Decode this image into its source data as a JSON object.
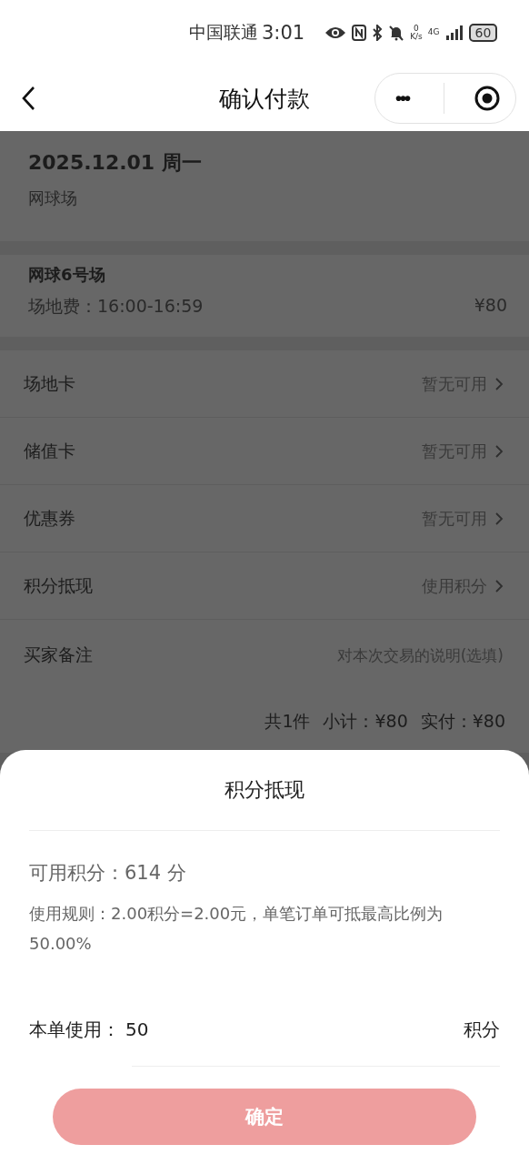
{
  "status_bar": {
    "carrier": "中国联通",
    "time": "3:01",
    "net_speed_value": "0",
    "net_speed_unit": "K/s",
    "network": "4G",
    "battery": "60"
  },
  "nav": {
    "title": "确认付款",
    "more": "•••"
  },
  "booking": {
    "date": "2025.12.01 周一",
    "venue": "网球场"
  },
  "court": {
    "name": "网球6号场",
    "fee_label": "场地费：16:00-16:59",
    "fee": "¥80"
  },
  "options": [
    {
      "label": "场地卡",
      "value": "暂无可用",
      "kind": "link"
    },
    {
      "label": "储值卡",
      "value": "暂无可用",
      "kind": "link"
    },
    {
      "label": "优惠券",
      "value": "暂无可用",
      "kind": "link"
    },
    {
      "label": "积分抵现",
      "value": "使用积分",
      "kind": "link"
    },
    {
      "label": "买家备注",
      "placeholder": "对本次交易的说明(选填)",
      "kind": "input"
    }
  ],
  "totals": [
    "共1件",
    "小计：¥80",
    "实付：¥80"
  ],
  "sheet": {
    "title": "积分抵现",
    "available": "可用积分：614 分",
    "rule": "使用规则：2.00积分=2.00元，单笔订单可抵最高比例为50.00%",
    "use_label": "本单使用：",
    "use_value": "50",
    "use_unit": "积分",
    "confirm": "确定",
    "confirm_disabled": true
  }
}
